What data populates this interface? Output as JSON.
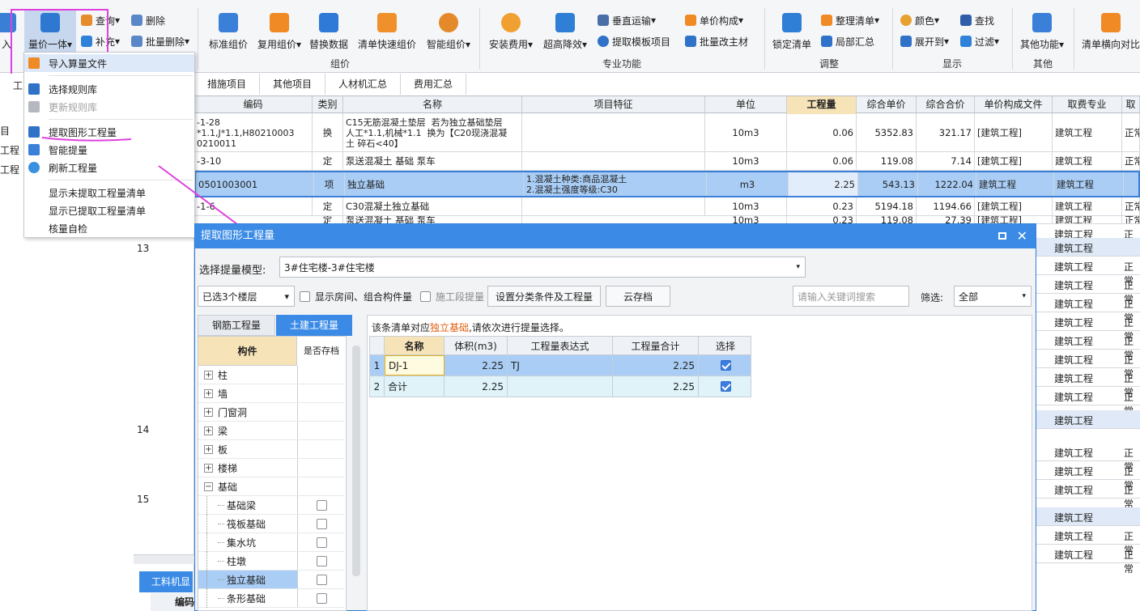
{
  "ribbon": {
    "left_clip": "入",
    "liangjia": "量价一体",
    "chaxun": "查询",
    "buchong": "补充",
    "shanchu": "删除",
    "piliang_shanchu": "批量删除",
    "biaozhun": "标准组价",
    "fuyong": "复用组价",
    "tihuan": "替换数据",
    "qingdan_kuaisu": "清单快速组价",
    "zhineng_zujia": "智能组价",
    "anzhuang": "安装费用",
    "chaogao": "超高降效",
    "chuizhi": "垂直运输",
    "tiqu_moban": "提取模板项目",
    "danjia_goucheng": "单价构成",
    "piliang_gai": "批量改主材",
    "suoding": "锁定清单",
    "zhengli": "整理清单",
    "jubu": "局部汇总",
    "yanse": "颜色",
    "zhankai": "展开到",
    "chazhao": "查找",
    "guolv": "过滤",
    "qita_gongneng": "其他功能",
    "qingdan_hengxiang": "清单横向对比",
    "groups": {
      "zujia": "组价",
      "zhuanye": "专业功能",
      "tiaozheng": "调整",
      "xianshi": "显示",
      "qita": "其他"
    }
  },
  "tabs": [
    "措施项目",
    "其他项目",
    "人材机汇总",
    "费用汇总"
  ],
  "left_panel": {
    "label1": "工",
    "item1": "目",
    "item2": "工程",
    "item3": "工程"
  },
  "grid": {
    "headers": [
      "编码",
      "类别",
      "名称",
      "项目特征",
      "单位",
      "工程量",
      "综合单价",
      "综合合价",
      "单价构成文件",
      "取费专业",
      "取"
    ],
    "rows": [
      {
        "code": "-1-28\n*1.1,J*1.1,H80210003\n0210011",
        "type": "换",
        "name": "C15无筋混凝土垫层  若为独立基础垫层\n人工*1.1,机械*1.1  换为【C20现浇混凝\n土 碎石<40】",
        "feature": "",
        "unit": "10m3",
        "qty": "0.06",
        "price": "5352.83",
        "total": "321.17",
        "file": "[建筑工程]",
        "major": "建筑工程",
        "extra": "正常"
      },
      {
        "code": "-3-10",
        "type": "定",
        "name": "泵送混凝土 基础 泵车",
        "feature": "",
        "unit": "10m3",
        "qty": "0.06",
        "price": "119.08",
        "total": "7.14",
        "file": "[建筑工程]",
        "major": "建筑工程",
        "extra": "正常"
      },
      {
        "code": "0501003001",
        "type": "项",
        "name": "独立基础",
        "feature": "1.混凝土种类:商品混凝土\n2.混凝土强度等级:C30",
        "unit": "m3",
        "qty": "2.25",
        "price": "543.13",
        "total": "1222.04",
        "file": "建筑工程",
        "major": "建筑工程",
        "extra": ""
      },
      {
        "code": "-1-6",
        "type": "定",
        "name": "C30混凝土独立基础",
        "feature": "",
        "unit": "10m3",
        "qty": "0.23",
        "price": "5194.18",
        "total": "1194.66",
        "file": "[建筑工程]",
        "major": "建筑工程",
        "extra": "正常"
      },
      {
        "code": "",
        "type": "定",
        "name": "泵送混凝土 基础 泵车",
        "feature": "",
        "unit": "10m3",
        "qty": "0.23",
        "price": "119.08",
        "total": "27.39",
        "file": "[建筑工程]",
        "major": "建筑工程",
        "extra": "正常"
      }
    ],
    "right_col_major": "建筑工程",
    "right_col_extra": "正常",
    "row_numbers": [
      "13",
      "14",
      "15"
    ],
    "bottom_tab": "工料机显",
    "bottom_header": "编码"
  },
  "menu": {
    "items": [
      "导入算量文件",
      "选择规则库",
      "更新规则库",
      "提取图形工程量",
      "智能提量",
      "刷新工程量",
      "显示未提取工程量清单",
      "显示已提取工程量清单",
      "核量自检"
    ]
  },
  "dialog": {
    "title": "提取图形工程量",
    "model_label": "选择提量模型:",
    "model_value": "3#住宅楼-3#住宅楼",
    "floors": "已选3个楼层",
    "show_rooms": "显示房间、组合构件量",
    "phase": "施工段提量",
    "set_btn": "设置分类条件及工程量",
    "cloud_btn": "云存档",
    "search_placeholder": "请输入关键词搜索",
    "filter_label": "筛选:",
    "filter_value": "全部",
    "tab_rebar": "钢筋工程量",
    "tab_civil": "土建工程量",
    "tree_head1": "构件",
    "tree_head2": "是否存档",
    "tree": [
      {
        "name": "柱",
        "pm": "+"
      },
      {
        "name": "墙",
        "pm": "+"
      },
      {
        "name": "门窗洞",
        "pm": "+"
      },
      {
        "name": "梁",
        "pm": "+"
      },
      {
        "name": "板",
        "pm": "+"
      },
      {
        "name": "楼梯",
        "pm": "+"
      },
      {
        "name": "基础",
        "pm": "−"
      }
    ],
    "tree_children": [
      "基础梁",
      "筏板基础",
      "集水坑",
      "柱墩",
      "独立基础",
      "条形基础"
    ],
    "hint_pre": "该条清单对应",
    "hint_em": "独立基础",
    "hint_post": ",请依次进行提量选择。",
    "table_headers": [
      "名称",
      "体积(m3)",
      "工程量表达式",
      "工程量合计",
      "选择"
    ],
    "table_rows": [
      {
        "no": "1",
        "name": "DJ-1",
        "vol": "2.25",
        "expr": "TJ",
        "sum": "2.25",
        "checked": true
      },
      {
        "no": "2",
        "name": "合计",
        "vol": "2.25",
        "expr": "",
        "sum": "2.25",
        "checked": true
      }
    ]
  },
  "colors": {
    "accent": "#3b8be6",
    "highlight_box": "#e040e0",
    "selected_row": "#a9cdf5",
    "header_highlight": "#f7e3b8",
    "hint_em": "#e06010"
  }
}
